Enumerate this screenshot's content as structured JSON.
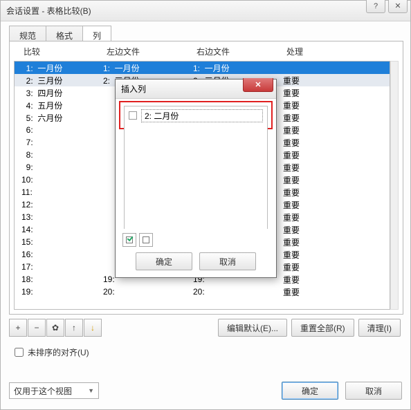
{
  "window": {
    "title": "会话设置 - 表格比较(B)"
  },
  "tabs": [
    {
      "label": "规范"
    },
    {
      "label": "格式"
    },
    {
      "label": "列"
    }
  ],
  "headers": {
    "compare": "比较",
    "left": "左边文件",
    "right": "右边文件",
    "handle": "处理"
  },
  "rows": [
    {
      "n": "1:",
      "name": "一月份",
      "l": "1:",
      "ln": "一月份",
      "r": "1:",
      "rn": "一月份",
      "h": "",
      "sel": true
    },
    {
      "n": "2:",
      "name": "三月份",
      "l": "2:",
      "ln": "三月份",
      "r": "2:",
      "rn": "三月份",
      "h": "重要"
    },
    {
      "n": "3:",
      "name": "四月份",
      "l": "",
      "ln": "",
      "r": "",
      "rn": "",
      "h": "重要"
    },
    {
      "n": "4:",
      "name": "五月份",
      "l": "",
      "ln": "",
      "r": "",
      "rn": "",
      "h": "重要"
    },
    {
      "n": "5:",
      "name": "六月份",
      "l": "",
      "ln": "",
      "r": "",
      "rn": "",
      "h": "重要"
    },
    {
      "n": "6:",
      "name": "",
      "l": "",
      "ln": "",
      "r": "",
      "rn": "",
      "h": "重要"
    },
    {
      "n": "7:",
      "name": "",
      "l": "",
      "ln": "",
      "r": "",
      "rn": "",
      "h": "重要"
    },
    {
      "n": "8:",
      "name": "",
      "l": "",
      "ln": "",
      "r": "",
      "rn": "",
      "h": "重要"
    },
    {
      "n": "9:",
      "name": "",
      "l": "",
      "ln": "",
      "r": "",
      "rn": "",
      "h": "重要"
    },
    {
      "n": "10:",
      "name": "",
      "l": "",
      "ln": "",
      "r": "",
      "rn": "",
      "h": "重要"
    },
    {
      "n": "11:",
      "name": "",
      "l": "",
      "ln": "",
      "r": "",
      "rn": "",
      "h": "重要"
    },
    {
      "n": "12:",
      "name": "",
      "l": "",
      "ln": "",
      "r": "",
      "rn": "",
      "h": "重要"
    },
    {
      "n": "13:",
      "name": "",
      "l": "",
      "ln": "",
      "r": "",
      "rn": "",
      "h": "重要"
    },
    {
      "n": "14:",
      "name": "",
      "l": "",
      "ln": "",
      "r": "",
      "rn": "",
      "h": "重要"
    },
    {
      "n": "15:",
      "name": "",
      "l": "",
      "ln": "",
      "r": "",
      "rn": "",
      "h": "重要"
    },
    {
      "n": "16:",
      "name": "",
      "l": "",
      "ln": "",
      "r": "",
      "rn": "",
      "h": "重要"
    },
    {
      "n": "17:",
      "name": "",
      "l": "",
      "ln": "",
      "r": "",
      "rn": "",
      "h": "重要"
    },
    {
      "n": "18:",
      "name": "",
      "l": "19:",
      "ln": "",
      "r": "19:",
      "rn": "",
      "h": "重要"
    },
    {
      "n": "19:",
      "name": "",
      "l": "20:",
      "ln": "",
      "r": "20:",
      "rn": "",
      "h": "重要"
    }
  ],
  "toolbar": {
    "add": "+",
    "remove": "−",
    "gear": "✿",
    "up": "↑",
    "down": "↓"
  },
  "actions": {
    "editDefault": "编辑默认(E)...",
    "resetAll": "重置全部(R)",
    "clear": "清理(I)"
  },
  "unsorted": "未排序的对齐(U)",
  "scope": "仅用于这个视图",
  "footer": {
    "ok": "确定",
    "cancel": "取消"
  },
  "dialog": {
    "title": "插入列",
    "item": "2: 二月份",
    "ok": "确定",
    "cancel": "取消"
  }
}
